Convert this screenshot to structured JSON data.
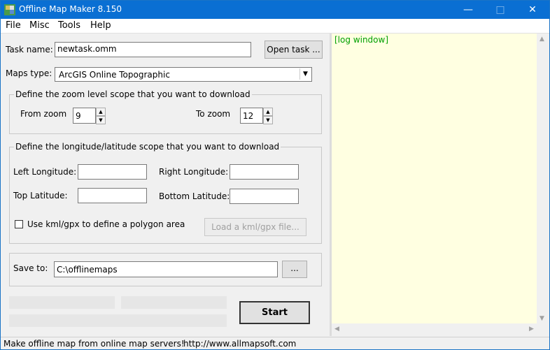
{
  "window": {
    "title": "Offline Map Maker 8.150"
  },
  "menu": [
    "File",
    "Misc",
    "Tools",
    "Help"
  ],
  "task": {
    "label": "Task name:",
    "value": "newtask.omm",
    "open_button": "Open task ..."
  },
  "maps": {
    "label": "Maps type:",
    "selected": "ArcGIS Online Topographic"
  },
  "zoom": {
    "group_label": "Define the zoom level scope that you want to download",
    "from_label": "From zoom",
    "from_value": "9",
    "to_label": "To zoom",
    "to_value": "12"
  },
  "scope": {
    "group_label": "Define the longitude/latitude scope that you want to download",
    "left_lon_label": "Left Longitude:",
    "left_lon_value": "",
    "right_lon_label": "Right Longitude:",
    "right_lon_value": "",
    "top_lat_label": "Top Latitude:",
    "top_lat_value": "",
    "bottom_lat_label": "Bottom Latitude:",
    "bottom_lat_value": "",
    "kml_label": "Use kml/gpx to define a polygon area",
    "kml_checked": false,
    "load_button": "Load a kml/gpx file..."
  },
  "save": {
    "label": "Save to:",
    "value": "C:\\offlinemaps",
    "browse_button": "..."
  },
  "start_button": "Start",
  "log": {
    "text": "[log window]"
  },
  "status": {
    "left": "Make offline map from online map servers!",
    "right": "http://www.allmapsoft.com"
  },
  "colors": {
    "titlebar": "#0a6fd3",
    "log_bg": "#ffffe1",
    "log_text": "#00a000"
  }
}
